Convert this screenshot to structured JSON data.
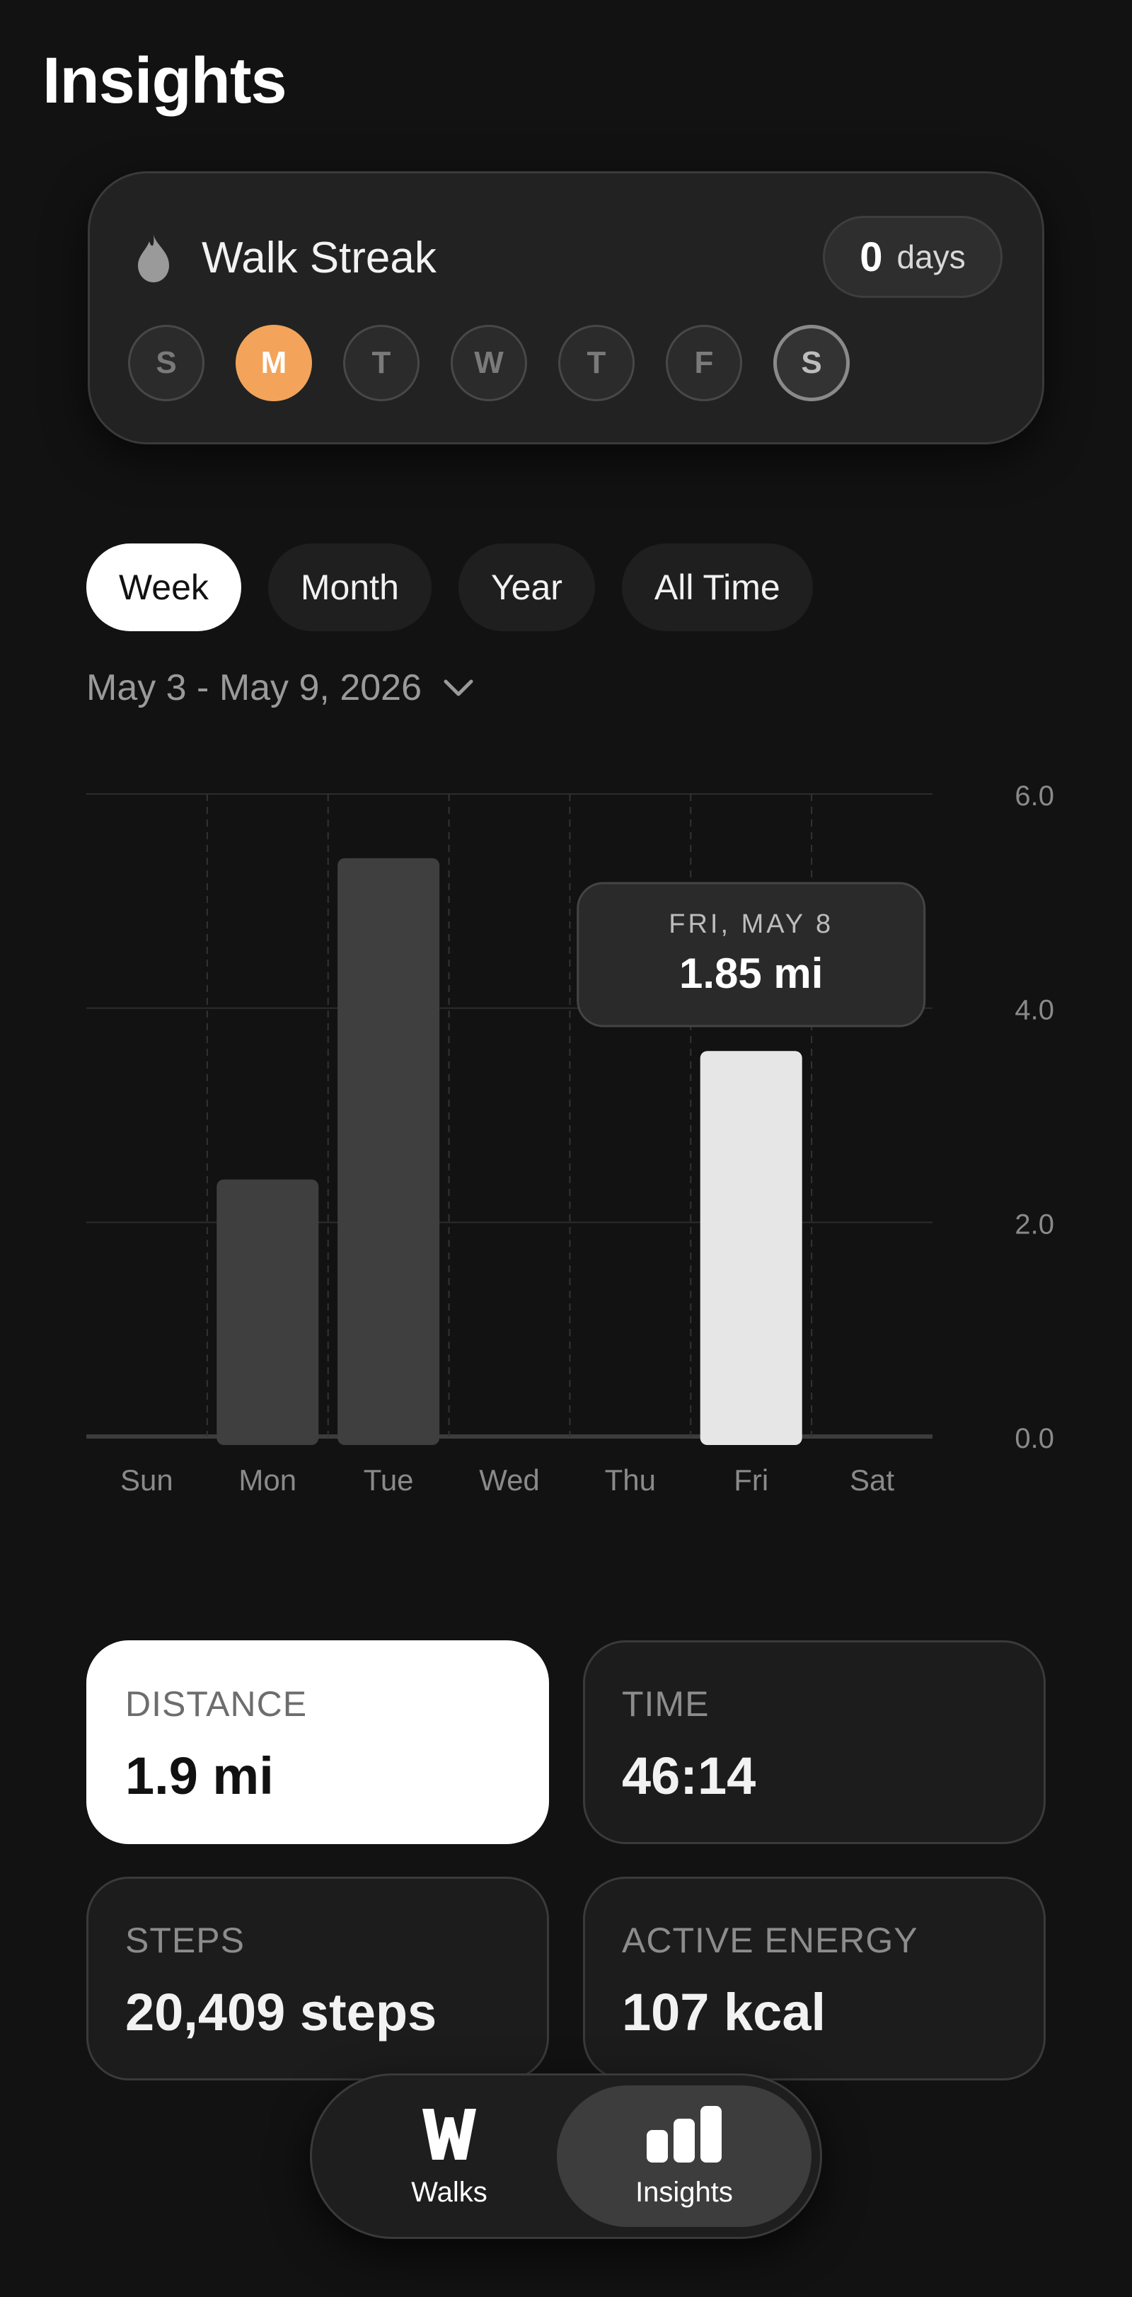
{
  "page": {
    "title": "Insights"
  },
  "streak": {
    "title": "Walk Streak",
    "count": "0",
    "unit": "days",
    "days": [
      {
        "letter": "S",
        "state": "inactive"
      },
      {
        "letter": "M",
        "state": "active"
      },
      {
        "letter": "T",
        "state": "inactive"
      },
      {
        "letter": "W",
        "state": "inactive"
      },
      {
        "letter": "T",
        "state": "inactive"
      },
      {
        "letter": "F",
        "state": "inactive"
      },
      {
        "letter": "S",
        "state": "today"
      }
    ],
    "colors": {
      "active": "#f3a45a"
    }
  },
  "tabs": [
    {
      "label": "Week",
      "selected": true
    },
    {
      "label": "Month",
      "selected": false
    },
    {
      "label": "Year",
      "selected": false
    },
    {
      "label": "All Time",
      "selected": false
    }
  ],
  "date_range": {
    "label": "May 3 - May 9, 2026"
  },
  "chart_data": {
    "type": "bar",
    "categories": [
      "Sun",
      "Mon",
      "Tue",
      "Wed",
      "Thu",
      "Fri",
      "Sat"
    ],
    "values": [
      0,
      2.4,
      5.4,
      0,
      0,
      3.6,
      0
    ],
    "ylim": [
      0,
      6
    ],
    "yticks": [
      "0.0",
      "2.0",
      "4.0",
      "6.0"
    ],
    "ytick_values": [
      0,
      2,
      4,
      6
    ],
    "highlight_index": 5,
    "tooltip": {
      "date": "FRI, MAY 8",
      "value": "1.85 mi"
    },
    "grid": true,
    "colors": {
      "bar": "#3f3f3f",
      "highlight": "#e6e6e6"
    }
  },
  "stats": [
    {
      "label": "DISTANCE",
      "value": "1.9 mi",
      "selected": true
    },
    {
      "label": "TIME",
      "value": "46:14",
      "selected": false
    },
    {
      "label": "STEPS",
      "value": "20,409 steps",
      "selected": false
    },
    {
      "label": "ACTIVE ENERGY",
      "value": "107 kcal",
      "selected": false
    }
  ],
  "nav": {
    "walks": {
      "label": "Walks",
      "icon": "walks-w-icon"
    },
    "insights": {
      "label": "Insights",
      "icon": "bar-chart-icon",
      "selected": true
    }
  }
}
